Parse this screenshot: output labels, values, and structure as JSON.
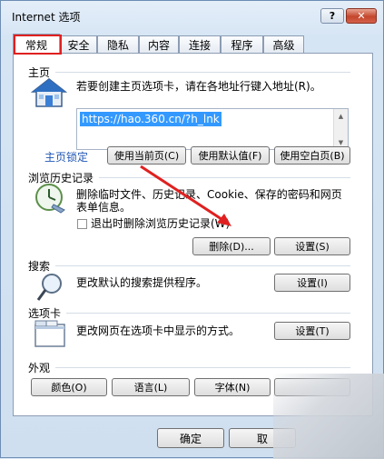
{
  "window": {
    "title": "Internet 选项",
    "help_label": "?",
    "close_label": "✕"
  },
  "tabs": [
    {
      "label": "常规",
      "active": true
    },
    {
      "label": "安全"
    },
    {
      "label": "隐私"
    },
    {
      "label": "内容"
    },
    {
      "label": "连接"
    },
    {
      "label": "程序"
    },
    {
      "label": "高级"
    }
  ],
  "homepage": {
    "heading": "主页",
    "description": "若要创建主页选项卡，请在各地址行键入地址(R)。",
    "url": "https://hao.360.cn/?h_lnk",
    "locked_label": "主页锁定",
    "use_current_label": "使用当前页(C)",
    "use_default_label": "使用默认值(F)",
    "use_blank_label": "使用空白页(B)"
  },
  "history": {
    "heading": "浏览历史记录",
    "description_line1": "删除临时文件、历史记录、Cookie、保存的密码和网页",
    "description_line2": "表单信息。",
    "delete_on_exit_label": "退出时删除浏览历史记录(W)",
    "delete_label": "删除(D)...",
    "settings_label": "设置(S)"
  },
  "search": {
    "heading": "搜索",
    "description": "更改默认的搜索提供程序。",
    "settings_label": "设置(I)"
  },
  "tabs_section": {
    "heading": "选项卡",
    "description": "更改网页在选项卡中显示的方式。",
    "settings_label": "设置(T)"
  },
  "appearance": {
    "heading": "外观",
    "colors_label": "颜色(O)",
    "languages_label": "语言(L)",
    "fonts_label": "字体(N)"
  },
  "footer": {
    "ok_label": "确定",
    "cancel_label": "取"
  },
  "colors": {
    "accent": "#3399ff",
    "annotation": "#e02020",
    "link": "#1f56b5"
  }
}
